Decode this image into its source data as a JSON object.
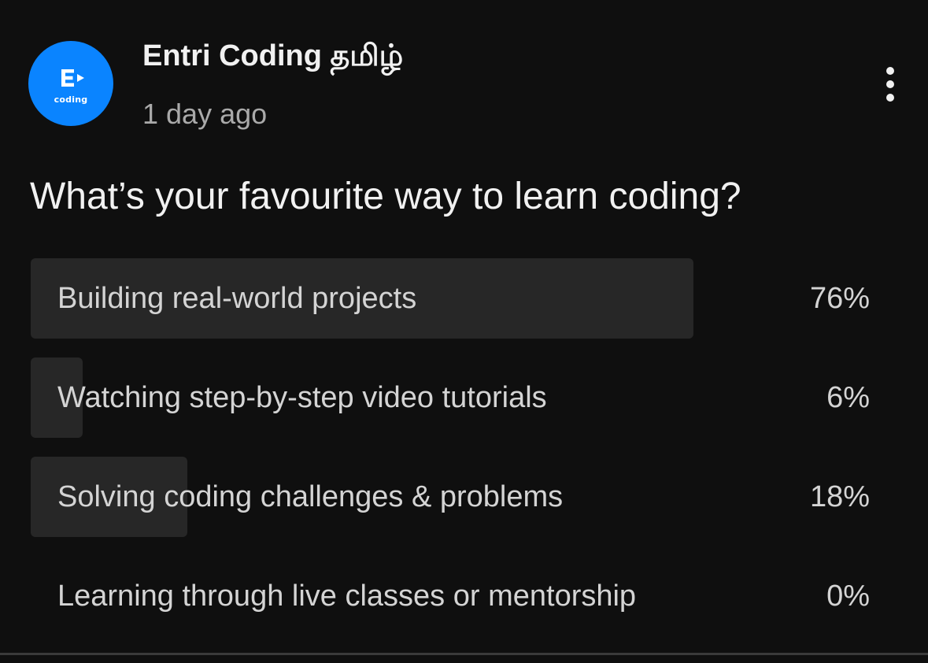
{
  "post": {
    "channel_name": "Entri Coding தமிழ்",
    "time_ago": "1 day ago",
    "avatar_text": "coding",
    "avatar_color": "#0a84ff",
    "avatar_icon": "entri-logo-icon",
    "menu_icon": "more-vert-icon"
  },
  "poll": {
    "question": "What’s your favourite way to learn coding?",
    "options": [
      {
        "label": "Building real-world projects",
        "percent_text": "76%",
        "percent": 76
      },
      {
        "label": "Watching step-by-step video tutorials",
        "percent_text": "6%",
        "percent": 6
      },
      {
        "label": "Solving coding challenges & problems",
        "percent_text": "18%",
        "percent": 18
      },
      {
        "label": "Learning through live classes or mentorship",
        "percent_text": "0%",
        "percent": 0
      }
    ],
    "fill_color": "#272727"
  }
}
